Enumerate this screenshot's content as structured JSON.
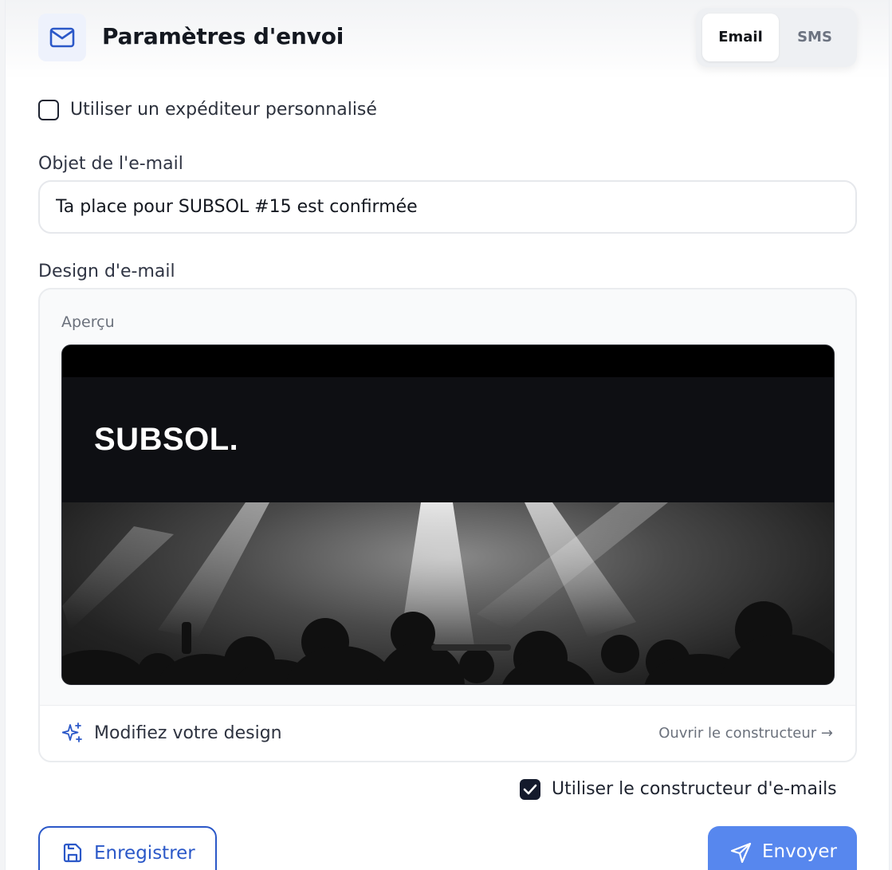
{
  "header": {
    "title": "Paramètres d'envoi",
    "icon": "mail-icon",
    "tabs": [
      {
        "label": "Email",
        "selected": true
      },
      {
        "label": "SMS",
        "selected": false
      }
    ]
  },
  "custom_sender": {
    "label": "Utiliser un expéditeur personnalisé",
    "checked": false
  },
  "subject": {
    "label": "Objet de l'e-mail",
    "value": "Ta place pour SUBSOL #15 est confirmée"
  },
  "design": {
    "label": "Design d'e-mail",
    "preview_label": "Aperçu",
    "brand": "SUBSOL.",
    "modify_label": "Modifiez votre design",
    "open_builder_label": "Ouvrir le constructeur →"
  },
  "use_builder": {
    "label": "Utiliser le constructeur d'e-mails",
    "checked": true
  },
  "actions": {
    "save_label": "Enregistrer",
    "send_label": "Envoyer"
  },
  "colors": {
    "accent": "#2b58c8",
    "send_button": "#5787ee",
    "preview_background": "#0e0f13"
  }
}
